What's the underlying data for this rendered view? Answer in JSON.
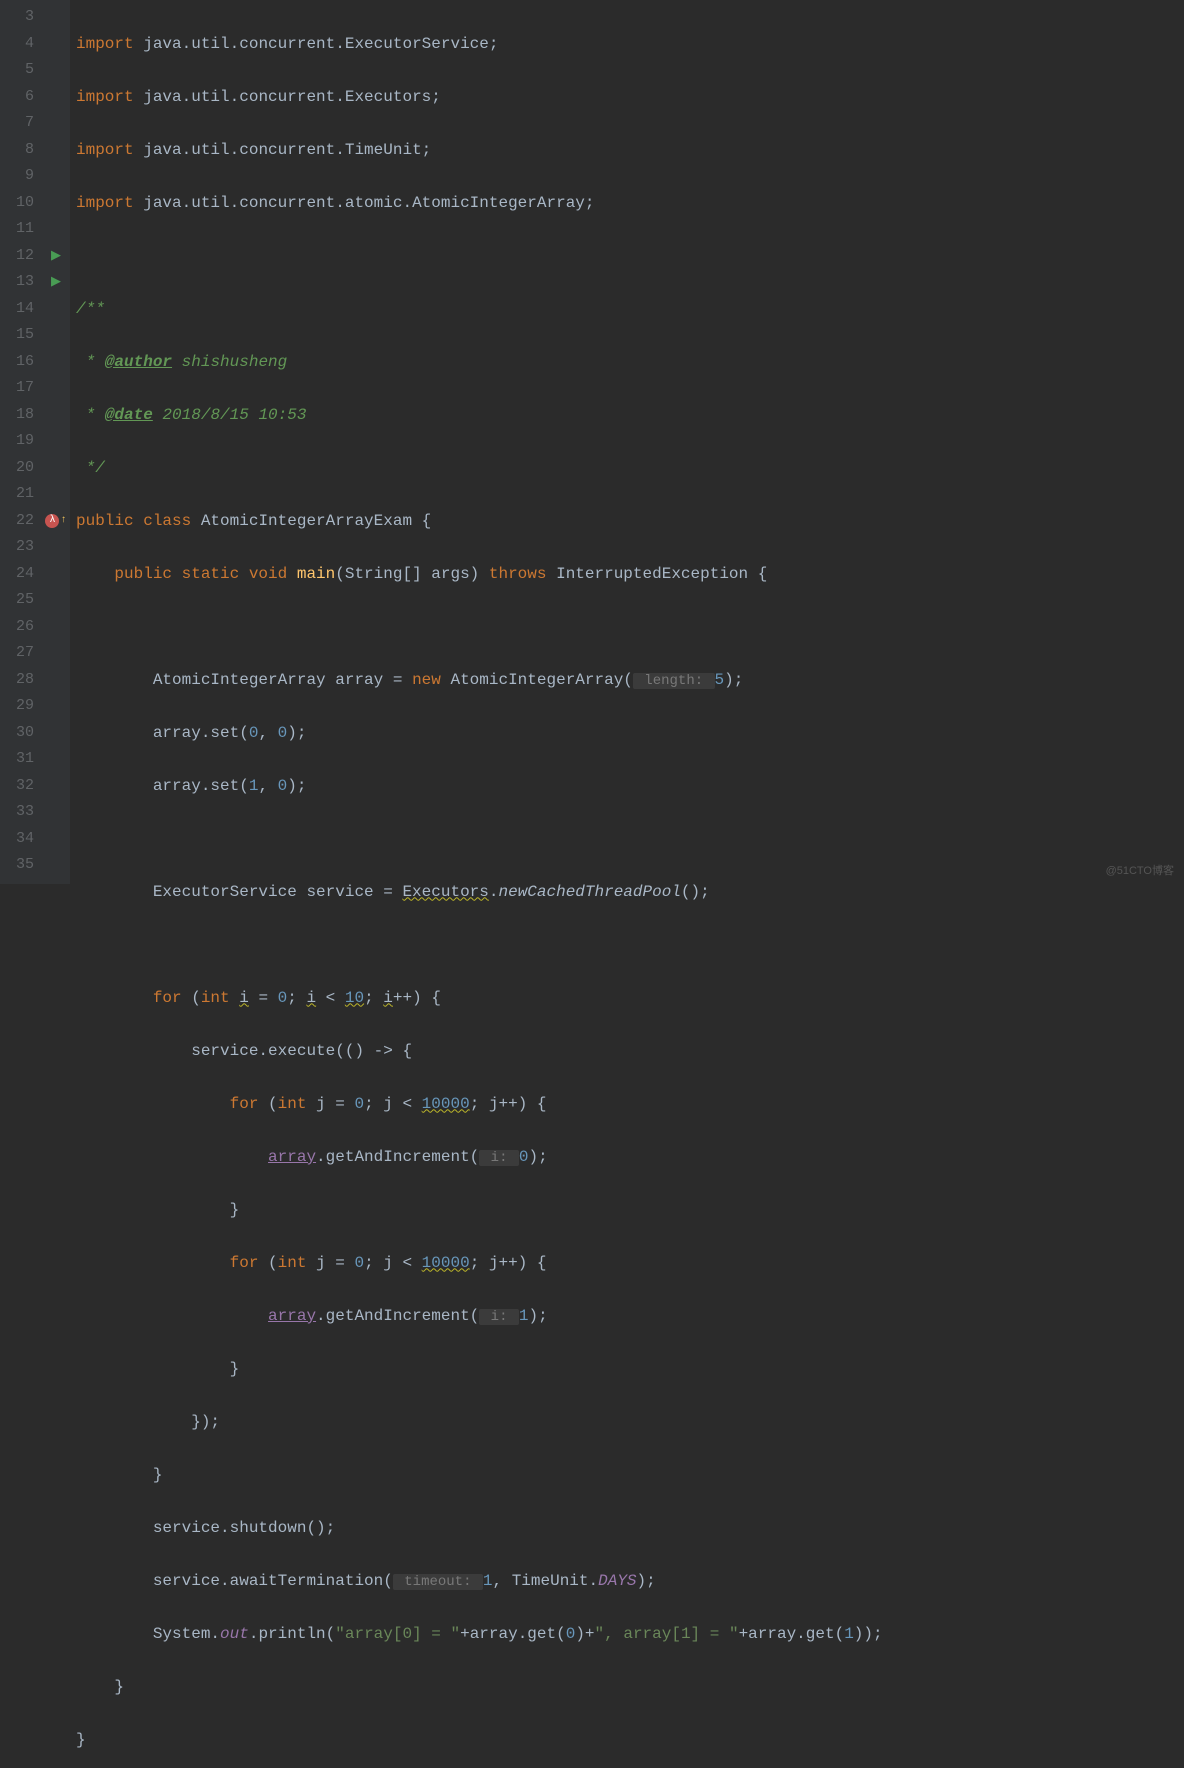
{
  "lineNumbers": [
    "3",
    "4",
    "5",
    "6",
    "7",
    "8",
    "9",
    "10",
    "11",
    "12",
    "13",
    "14",
    "15",
    "16",
    "17",
    "18",
    "19",
    "20",
    "21",
    "22",
    "23",
    "24",
    "25",
    "26",
    "27",
    "28",
    "29",
    "30",
    "31",
    "32",
    "33",
    "34",
    "35"
  ],
  "gutterIcons": {
    "12": "run",
    "13": "run",
    "22": "lambda"
  },
  "code": {
    "l3": {
      "kw": "import",
      "pkg": "java.util.concurrent.ExecutorService;"
    },
    "l4": {
      "kw": "import",
      "pkg": "java.util.concurrent.Executors;"
    },
    "l5": {
      "kw": "import",
      "pkg": "java.util.concurrent.TimeUnit;"
    },
    "l6": {
      "kw": "import",
      "pkg": "java.util.concurrent.atomic.AtomicIntegerArray;"
    },
    "l8": {
      "doc": "/**"
    },
    "l9": {
      "pre": " * ",
      "tag": "@author",
      "txt": " shishusheng"
    },
    "l10": {
      "pre": " * ",
      "tag": "@date",
      "txt": " 2018/8/15 10:53"
    },
    "l11": {
      "doc": " */"
    },
    "l12": {
      "kw1": "public class ",
      "cls": "AtomicIntegerArrayExam ",
      "brace": "{"
    },
    "l13": {
      "indent": "    ",
      "kw1": "public static void ",
      "method": "main",
      "params": "(String[] args) ",
      "kw2": "throws ",
      "exc": "InterruptedException {"
    },
    "l15": {
      "indent": "        ",
      "type": "AtomicIntegerArray array = ",
      "kw": "new ",
      "ctor": "AtomicIntegerArray(",
      "hint": " length: ",
      "val": "5",
      "end": ");"
    },
    "l16": {
      "indent": "        ",
      "txt": "array.set(",
      "n1": "0",
      "c": ", ",
      "n2": "0",
      "end": ");"
    },
    "l17": {
      "indent": "        ",
      "txt": "array.set(",
      "n1": "1",
      "c": ", ",
      "n2": "0",
      "end": ");"
    },
    "l19": {
      "indent": "        ",
      "type": "ExecutorService service = ",
      "cls": "Executors",
      "dot": ".",
      "method": "newCachedThreadPool",
      "end": "();"
    },
    "l21": {
      "indent": "        ",
      "kw": "for ",
      "p1": "(",
      "kw2": "int ",
      "var": "i",
      "eq": " = ",
      "n0": "0",
      "sc": "; ",
      "var2": "i",
      "lt": " < ",
      "n1": "10",
      "sc2": "; ",
      "var3": "i",
      "inc": "++) {"
    },
    "l22": {
      "indent": "            ",
      "txt": "service.execute(() -> {"
    },
    "l23": {
      "indent": "                ",
      "kw": "for ",
      "p1": "(",
      "kw2": "int ",
      "var": "j = ",
      "n0": "0",
      "sc": "; j < ",
      "n1": "10000",
      "sc2": "; j++) {"
    },
    "l24": {
      "indent": "                    ",
      "arr": "array",
      "txt": ".getAndIncrement(",
      "hint": " i: ",
      "n": "0",
      "end": ");"
    },
    "l25": {
      "indent": "                ",
      "txt": "}"
    },
    "l26": {
      "indent": "                ",
      "kw": "for ",
      "p1": "(",
      "kw2": "int ",
      "var": "j = ",
      "n0": "0",
      "sc": "; j < ",
      "n1": "10000",
      "sc2": "; j++) {"
    },
    "l27": {
      "indent": "                    ",
      "arr": "array",
      "txt": ".getAndIncrement(",
      "hint": " i: ",
      "n": "1",
      "end": ");"
    },
    "l28": {
      "indent": "                ",
      "txt": "}"
    },
    "l29": {
      "indent": "            ",
      "txt": "});"
    },
    "l30": {
      "indent": "        ",
      "txt": "}"
    },
    "l31": {
      "indent": "        ",
      "txt": "service.shutdown();"
    },
    "l32": {
      "indent": "        ",
      "txt": "service.awaitTermination(",
      "hint": " timeout: ",
      "n": "1",
      "c": ", TimeUnit.",
      "f": "DAYS",
      "end": ");"
    },
    "l33": {
      "indent": "        ",
      "sys": "System.",
      "out": "out",
      "p": ".println(",
      "s1": "\"array[0] = \"",
      "plus": "+array.get(",
      "n0": "0",
      "mid": ")+",
      "s2": "\", array[1] = \"",
      "plus2": "+array.get(",
      "n1": "1",
      "end": "));"
    },
    "l34": {
      "indent": "    ",
      "txt": "}"
    },
    "l35": {
      "txt": "}"
    }
  },
  "watermark": "@51CTO博客"
}
